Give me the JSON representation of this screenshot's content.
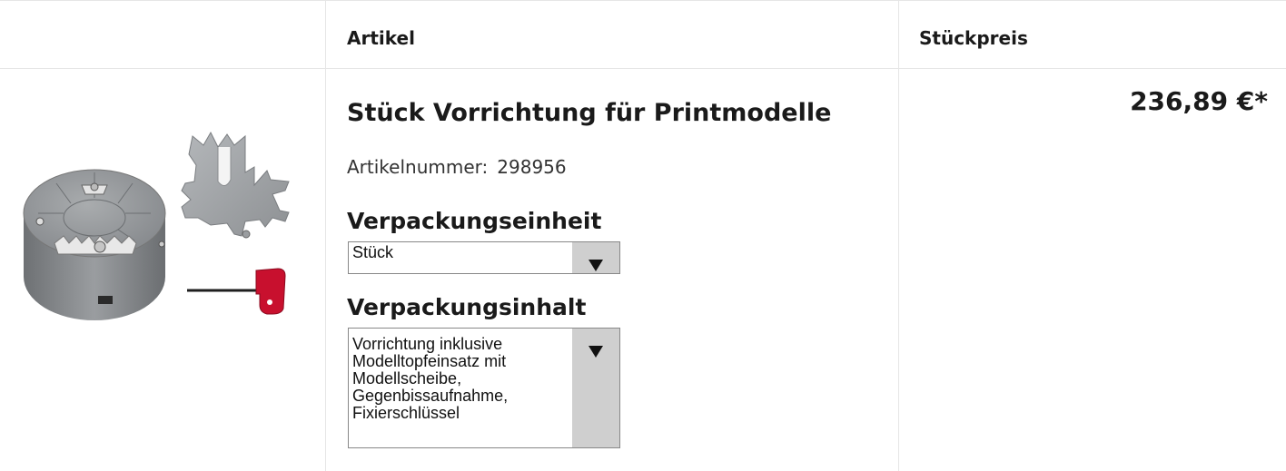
{
  "table": {
    "headers": {
      "article": "Artikel",
      "unit_price": "Stückpreis"
    }
  },
  "product": {
    "title": "Stück Vorrichtung für Printmodelle",
    "article_number_label": "Artikelnummer:",
    "article_number": "298956",
    "packaging_unit_label": "Verpackungseinheit",
    "packaging_unit_value": "Stück",
    "packaging_content_label": "Verpackungsinhalt",
    "packaging_content_lines": [
      "Vorrichtung inklusive",
      "Modelltopfeinsatz mit",
      "Modellscheibe,",
      "Gegenbissaufnahme,",
      "Fixierschlüssel"
    ],
    "price": "236,89 €*",
    "image_icon": "product-photo-fixture-device"
  },
  "colors": {
    "divider": "#e6e6e6",
    "select_arrow_bg": "#cfcfcf",
    "key_handle": "#c8102e",
    "device_grey": "#8a8d90"
  }
}
